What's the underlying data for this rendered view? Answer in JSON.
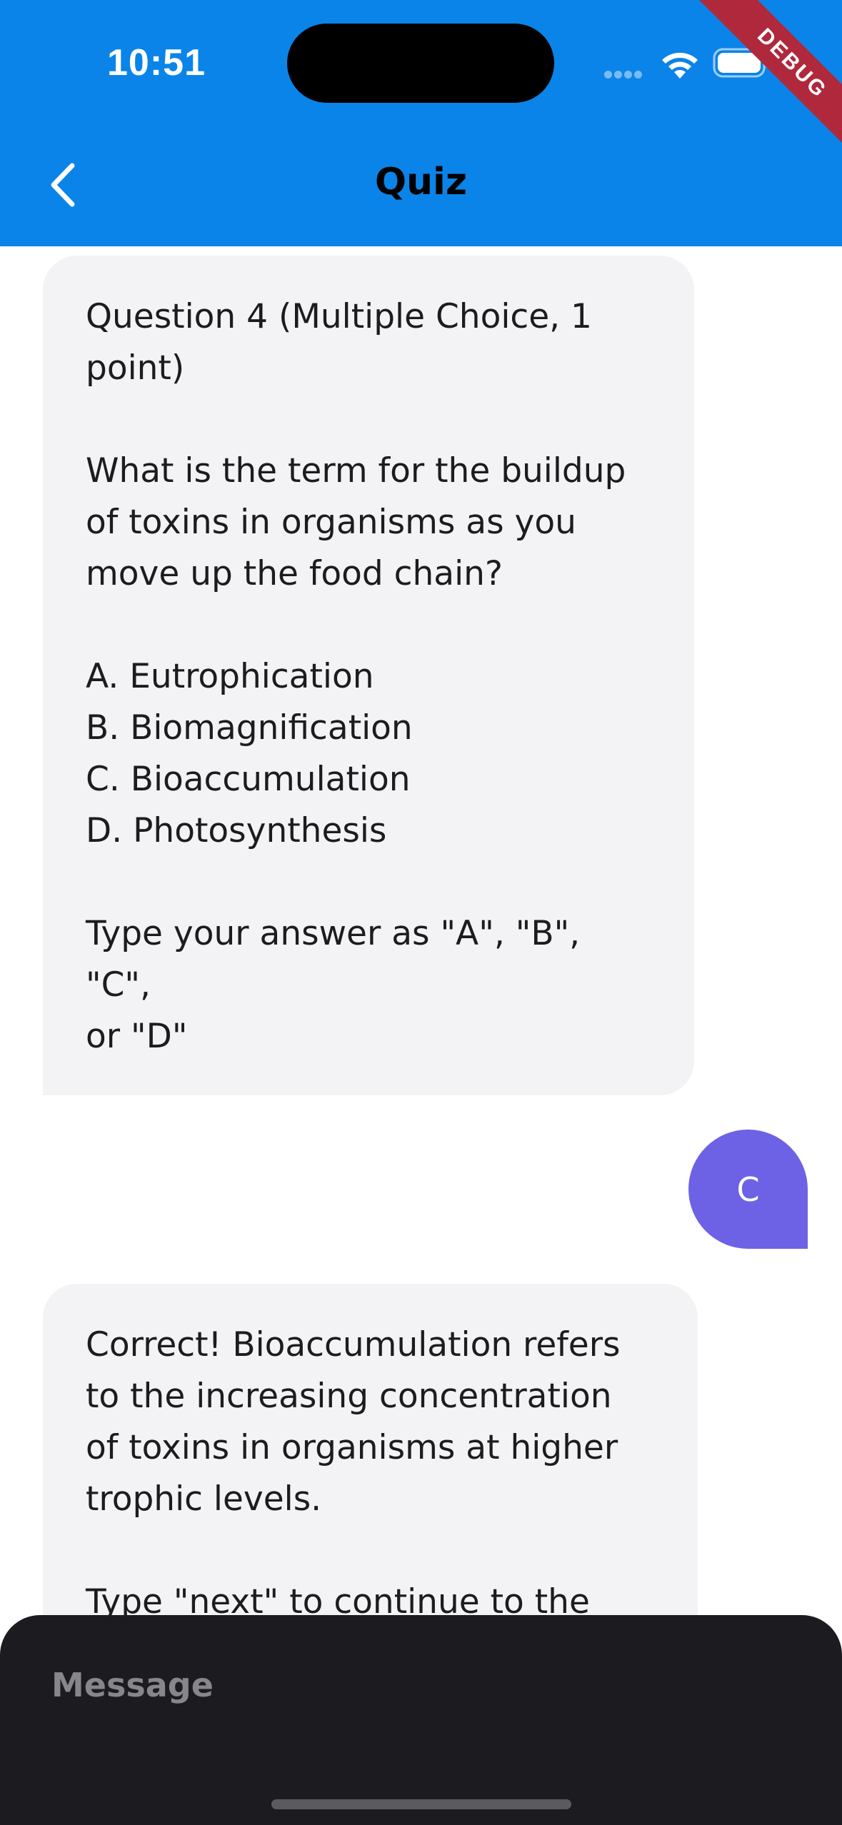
{
  "status_bar": {
    "time": "10:51"
  },
  "debug_banner": "DEBUG",
  "header": {
    "title": "Quiz",
    "back_icon": "chevron-left-icon",
    "background": "#0A84E8"
  },
  "messages": [
    {
      "sender": "bot",
      "heading": "Question 4 (Multiple Choice, 1\npoint)",
      "question": "What is the term for the buildup\nof toxins in organisms as you\nmove up the food chain?",
      "options": [
        "A. Eutrophication",
        "B. Biomagnification",
        "C. Bioaccumulation",
        "D. Photosynthesis"
      ],
      "instruction": "Type your answer as \"A\", \"B\", \"C\",\nor \"D\""
    },
    {
      "sender": "user",
      "text": "C",
      "color": "#6D62E5"
    },
    {
      "sender": "bot",
      "feedback": "Correct! Bioaccumulation refers\nto the increasing concentration\nof toxins in organisms at higher\ntrophic levels.",
      "next_prompt": "Type \"next\" to continue to the"
    }
  ],
  "input": {
    "placeholder": "Message",
    "value": ""
  }
}
